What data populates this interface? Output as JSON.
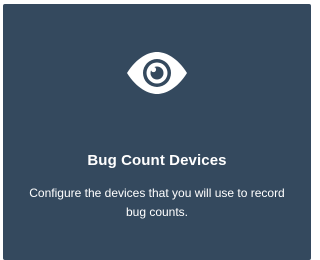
{
  "card": {
    "icon": "eye-icon",
    "title": "Bug Count Devices",
    "description": "Configure the devices that you will use to record bug counts."
  },
  "colors": {
    "card_background": "#34495e",
    "text": "#ffffff"
  }
}
